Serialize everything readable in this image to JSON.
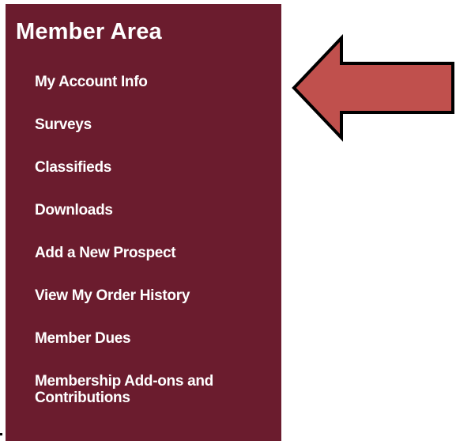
{
  "panel": {
    "title": "Member Area",
    "background": "#6b1c2e",
    "items": [
      {
        "label": "My Account Info"
      },
      {
        "label": "Surveys"
      },
      {
        "label": "Classifieds"
      },
      {
        "label": "Downloads"
      },
      {
        "label": "Add a New Prospect"
      },
      {
        "label": "View My Order History"
      },
      {
        "label": "Member Dues"
      },
      {
        "label": "Membership Add-ons and Contributions"
      }
    ]
  },
  "annotation": {
    "icon": "arrow-left-icon",
    "fill": "#c0504d",
    "stroke": "#000000"
  }
}
